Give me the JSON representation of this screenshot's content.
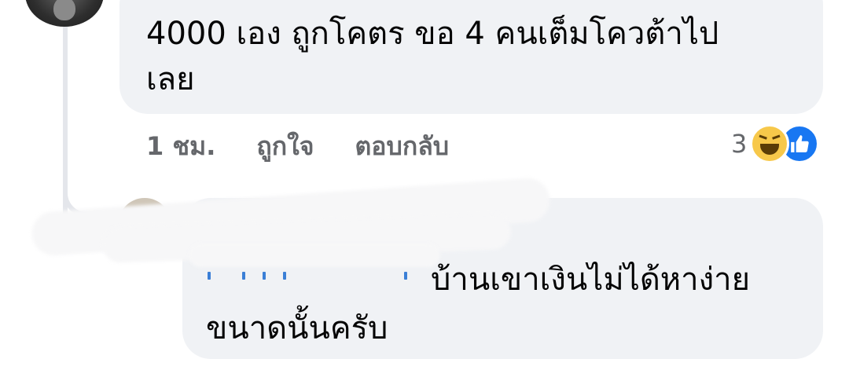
{
  "comment": {
    "text_line1": "4000 เอง ถูกโคตร ขอ 4 คนเต็มโควต้าไป",
    "text_line2": "เลย",
    "time": "1 ชม.",
    "like_action": "ถูกใจ",
    "reply_action": "ตอบกลับ",
    "reaction_count": "3",
    "reaction_icons": [
      "haha-icon",
      "like-icon"
    ]
  },
  "reply": {
    "text_line1": "บ้านเขาเงินไม่ได้หาง่าย",
    "text_line2": "ขนาดนั้นครับ"
  },
  "colors": {
    "bubble": "#f0f2f5",
    "meta_text": "#65676b",
    "like_blue": "#1877f2",
    "haha_yellow": "#f7c84a"
  }
}
